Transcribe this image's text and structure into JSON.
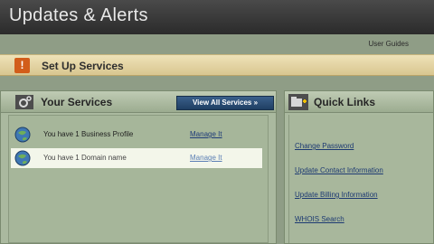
{
  "header": {
    "title": "Updates & Alerts"
  },
  "links": {
    "user_guides": "User Guides"
  },
  "setup": {
    "label": "Set Up Services",
    "icon": "exclamation-icon"
  },
  "services": {
    "title": "Your Services",
    "view_all": "View All Services »",
    "rows": [
      {
        "text": "You have 1 Business Profile",
        "action": "Manage It"
      },
      {
        "text": "You have 1 Domain name",
        "action": "Manage It"
      }
    ]
  },
  "quick_links": {
    "title": "Quick Links",
    "items": [
      "Change Password",
      "Update Contact Information",
      "Update Billing Information",
      "WHOIS Search"
    ]
  },
  "colors": {
    "accent": "#d25d1a",
    "link": "#1d3a72",
    "button": "#2a4c74"
  }
}
